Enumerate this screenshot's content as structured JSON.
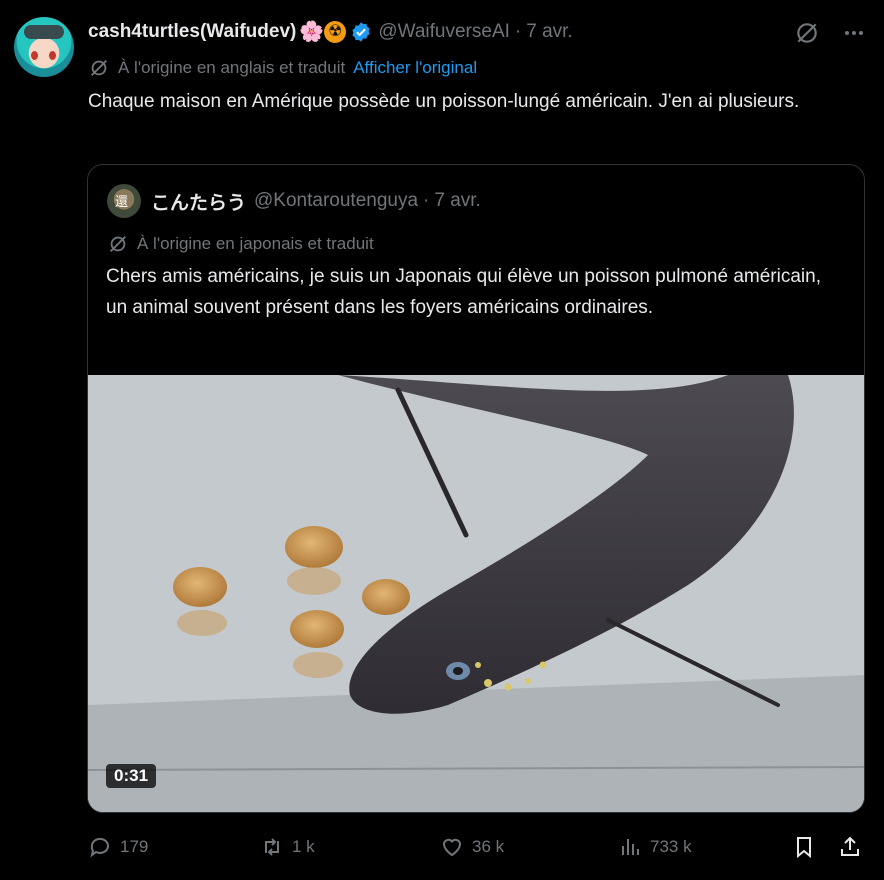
{
  "tweet": {
    "display_name": "cash4turtles(Waifudev)",
    "emojis": [
      "🌸",
      "☢"
    ],
    "handle": "@WaifuverseAI",
    "separator": "·",
    "date": "7 avr.",
    "translation_note": "À l'origine en anglais et traduit",
    "show_original": "Afficher l'original",
    "text": "Chaque maison en Amérique possède un poisson-lungé américain. J'en ai plusieurs."
  },
  "quote": {
    "display_name": "こんたらう",
    "avatar_glyph": "還",
    "handle": "@Kontaroutenguya",
    "separator": "·",
    "date": "7 avr.",
    "translation_note": "À l'origine en japonais et traduit",
    "text": "Chers amis américains, je suis un Japonais qui élève un poisson pulmoné américain, un animal souvent présent dans les foyers américains ordinaires.",
    "video_duration": "0:31"
  },
  "actions": {
    "replies": "179",
    "reposts": "1 k",
    "likes": "36 k",
    "views": "733 k"
  },
  "colors": {
    "background": "#000000",
    "text": "#e7e9ea",
    "muted": "#71767b",
    "link": "#1d9bf0",
    "border": "#2f3336"
  }
}
